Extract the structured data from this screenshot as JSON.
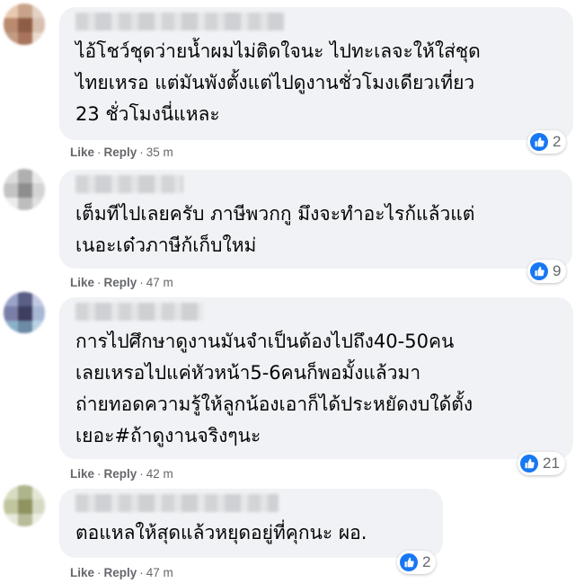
{
  "comments": [
    {
      "text": "ไอ้โชว์ชุดว่ายน้ำผมไม่ติดใจนะ ไปทะเลจะให้ใส่ชุด\nไทยเหรอ แต่มันพังตั้งแต่ไปดูงานชั่วโมงเดียวเที่ยว\n23 ชั่วโมงนี่แหละ",
      "like_label": "Like",
      "reply_label": "Reply",
      "time": "35 m",
      "reactions": "2"
    },
    {
      "text": "เต็มทีไปเลยครับ ภาษีพวกกู มึงจะทำอะไรก้แล้วแต่\nเนอะเด๋วภาษีก้เก็บใหม่",
      "like_label": "Like",
      "reply_label": "Reply",
      "time": "47 m",
      "reactions": "9"
    },
    {
      "text": "การไปศึกษาดูงานมันจำเป็นต้องไปถึง40-50คน\nเลยเหรอไปแค่หัวหน้า5-6คนก็พอมั้งแล้วมา\nถ่ายทอดความรู้ให้ลูกน้องเอาก็ได้ประหยัดงบใด้ตั้ง\nเยอะ#ถ้าดูงานจริงๆนะ",
      "like_label": "Like",
      "reply_label": "Reply",
      "time": "42 m",
      "reactions": "21"
    },
    {
      "text": "ตอแหลให้สุดแล้วหยุดอยู่ที่คุกนะ ผอ.",
      "like_label": "Like",
      "reply_label": "Reply",
      "time": "47 m",
      "reactions": "2"
    }
  ],
  "colors": {
    "bubble": "#f0f2f5",
    "meta": "#65676b",
    "like_blue": "#1877f2",
    "text": "#050505"
  },
  "icons": [
    "like-reaction-icon"
  ]
}
